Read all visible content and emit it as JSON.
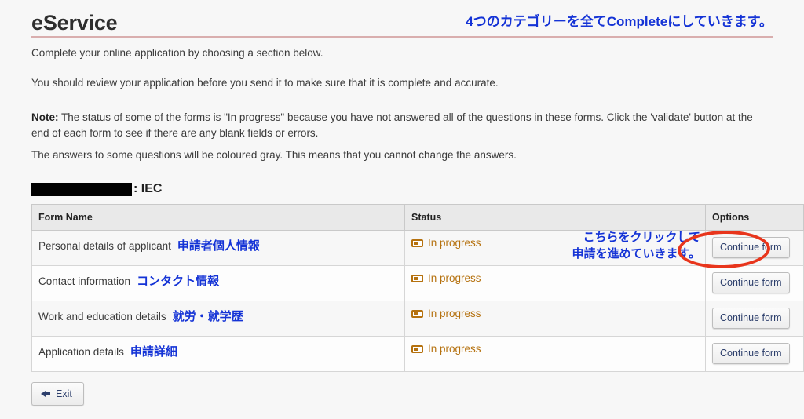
{
  "header": {
    "app_title": "eService",
    "annotation_top": "4つのカテゴリーを全てCompleteにしていきます。",
    "annotation_color": "#1433d6",
    "rule_color": "#d9aeae"
  },
  "intro": {
    "paragraph_1": "Complete your online application by choosing a section below.",
    "paragraph_2": "You should review your application before you send it to make sure that it is complete and accurate.",
    "note_label": "Note:",
    "note_body": " The status of some of the forms is \"In progress\" because you have not answered all of the questions in these forms. Click the 'validate' button at the end of each form to see if there are any blank fields or errors.",
    "paragraph_4": "The answers to some questions will be coloured gray. This means that you cannot change the answers."
  },
  "section": {
    "redacted_label": "",
    "suffix": ": IEC"
  },
  "table": {
    "columns": [
      "Form Name",
      "Status",
      "Options"
    ],
    "rows": [
      {
        "name_en": "Personal details of applicant",
        "name_jp": "申請者個人情報",
        "status": "In progress",
        "status_icon": "form-badge-icon",
        "button": "Continue form",
        "highlighted": true
      },
      {
        "name_en": "Contact information",
        "name_jp": "コンタクト情報",
        "status": "In progress",
        "status_icon": "form-badge-icon",
        "button": "Continue form",
        "highlighted": false
      },
      {
        "name_en": "Work and education details",
        "name_jp": "就労・就学歴",
        "status": "In progress",
        "status_icon": "form-badge-icon",
        "button": "Continue form",
        "highlighted": false
      },
      {
        "name_en": "Application details",
        "name_jp": "申請詳細",
        "status": "In progress",
        "status_icon": "form-badge-icon",
        "button": "Continue form",
        "highlighted": false
      }
    ],
    "status_color": "#b5710e"
  },
  "annotations": {
    "click_here_line1": "こちらをクリックして",
    "click_here_line2": "申請を進めていきます。",
    "oval_color": "#e8351c"
  },
  "footer": {
    "exit_label": "Exit",
    "exit_icon": "arrow-left-icon"
  }
}
